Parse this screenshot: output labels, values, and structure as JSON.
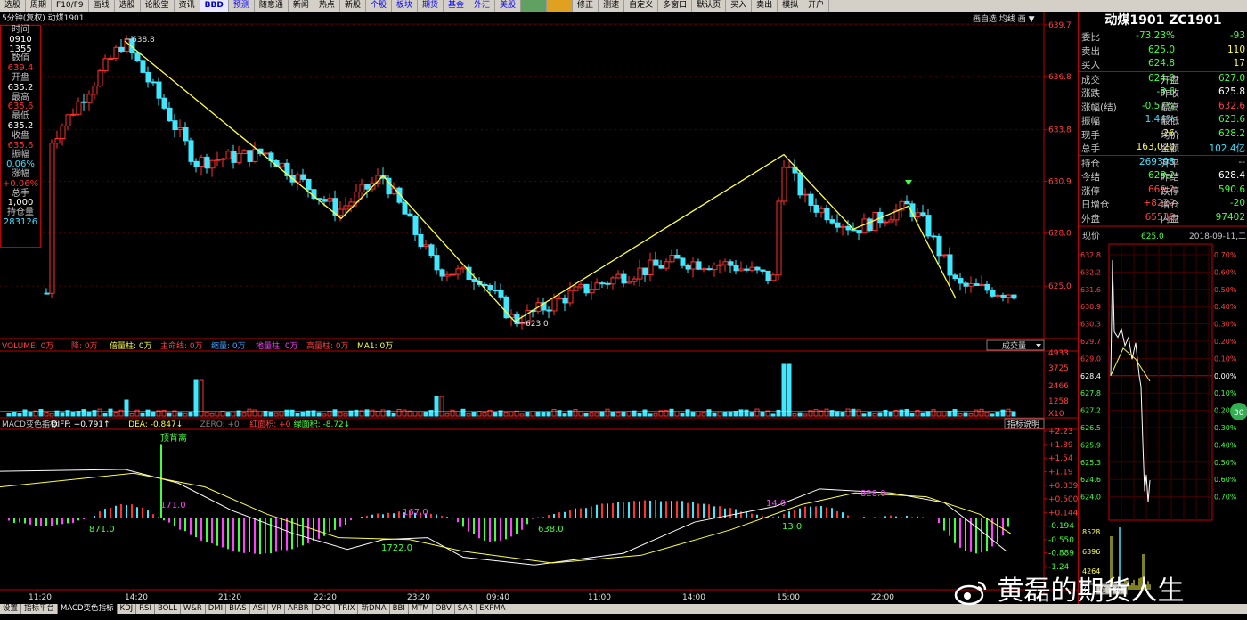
{
  "toolbar": {
    "items": [
      "选股",
      "周期",
      "F10/F9",
      "画线",
      "选股",
      "论股堂",
      "资讯",
      "BBD",
      "预测",
      "随意通",
      "新闻",
      "热点",
      "新股",
      "个股",
      "板块",
      "期货",
      "基金",
      "外汇",
      "美股",
      "",
      "",
      "修正",
      "测速",
      "自定义",
      "多窗口",
      "默认页",
      "买入",
      "卖出",
      "模拟",
      "开户"
    ]
  },
  "chart": {
    "header": "5分钟(复权) 动煤1901",
    "top_right_buttons": "画自选 均线 画 ▼",
    "price_axis": [
      "639.7",
      "636.8",
      "633.8",
      "630.9",
      "628.0",
      "625.0"
    ],
    "annotations": {
      "high": "638.8",
      "low": "623.0"
    },
    "time_axis": [
      "11:20",
      "14:20",
      "21:20",
      "22:20",
      "23:20",
      "09:40",
      "11:00",
      "14:00",
      "15:00",
      "22:00"
    ]
  },
  "info_panel": {
    "rows": [
      {
        "l": "时间",
        "v": "0910"
      },
      {
        "l": "",
        "v": "1355"
      },
      {
        "l": "数值",
        "v": "639.4",
        "c": "vred"
      },
      {
        "l": "开盘",
        "v": "635.2",
        "c": "vwhite"
      },
      {
        "l": "最高",
        "v": "635.6",
        "c": "vred"
      },
      {
        "l": "最低",
        "v": "635.2",
        "c": "vwhite"
      },
      {
        "l": "收盘",
        "v": "635.6",
        "c": "vred"
      },
      {
        "l": "振幅",
        "v": "0.06%",
        "c": "vcyan"
      },
      {
        "l": "涨幅",
        "v": "+0.06%",
        "c": "vred"
      },
      {
        "l": "总手",
        "v": "1,000",
        "c": "vwhite"
      },
      {
        "l": "持仓量",
        "v": "283126",
        "c": "vcyan"
      }
    ]
  },
  "volume": {
    "legend": [
      {
        "t": "VOLUME: 0万",
        "c": "#ff4040"
      },
      {
        "t": "降: 0万",
        "c": "#ff4040"
      },
      {
        "t": "倍量柱: 0万",
        "c": "#ffff40"
      },
      {
        "t": "主命线: 0万",
        "c": "#ff4040"
      },
      {
        "t": "缩量: 0万",
        "c": "#40a0ff"
      },
      {
        "t": "地量柱: 0万",
        "c": "#ff40ff"
      },
      {
        "t": "高量柱: 0万",
        "c": "#ff4040"
      },
      {
        "t": "MA1: 0万",
        "c": "#ffff40"
      }
    ],
    "selector": "成交量",
    "axis": [
      "4933",
      "3725",
      "2466",
      "1258",
      "X10"
    ]
  },
  "macd": {
    "legend": [
      {
        "t": "MACD变色指标",
        "c": "#c8c8c8"
      },
      {
        "t": "DIFF: +0.791↑",
        "c": "#ffffff"
      },
      {
        "t": "DEA: -0.847↓",
        "c": "#ffff40"
      },
      {
        "t": "ZERO: +0",
        "c": "#808080"
      },
      {
        "t": "红面积: +0",
        "c": "#ff4040"
      },
      {
        "t": "绿面积: -8.72↓",
        "c": "#40ff40"
      }
    ],
    "help": "指标说明",
    "axis": [
      "+2.23",
      "+1.89",
      "+1.54",
      "+1.19",
      "+0.839",
      "+0.500",
      "+0.144",
      "-0.194",
      "-0.550",
      "-0.889",
      "-1.24"
    ],
    "labels": [
      "顶背离",
      "171.0",
      "871.0",
      "167.0",
      "1722.0",
      "638.0",
      "14.0",
      "13.0",
      "828.0"
    ]
  },
  "quote": {
    "title": "动煤1901 ZC1901",
    "rows": [
      [
        {
          "t": "委比",
          "c": "#c8c8c8"
        },
        {
          "t": "-73.23%",
          "c": "#40ff40"
        },
        {
          "t": "",
          "c": ""
        },
        {
          "t": "-93",
          "c": "#40ff40"
        }
      ],
      [
        {
          "t": "卖出",
          "c": "#c8c8c8"
        },
        {
          "t": "625.0",
          "c": "#40ff40"
        },
        {
          "t": "",
          "c": ""
        },
        {
          "t": "110",
          "c": "#ffff40"
        }
      ],
      [
        {
          "t": "买入",
          "c": "#c8c8c8"
        },
        {
          "t": "624.8",
          "c": "#40ff40"
        },
        {
          "t": "",
          "c": ""
        },
        {
          "t": "17",
          "c": "#ffff40"
        }
      ],
      [
        {
          "t": "成交",
          "c": "#c8c8c8"
        },
        {
          "t": "624.0",
          "c": "#40ff40"
        },
        {
          "t": "开盘",
          "c": "#c8c8c8"
        },
        {
          "t": "627.0",
          "c": "#40ff40"
        }
      ],
      [
        {
          "t": "涨跌",
          "c": "#c8c8c8"
        },
        {
          "t": "-3.6",
          "c": "#40ff40"
        },
        {
          "t": "昨收",
          "c": "#c8c8c8"
        },
        {
          "t": "625.8",
          "c": "#ffffff"
        }
      ],
      [
        {
          "t": "涨幅(结)",
          "c": "#c8c8c8"
        },
        {
          "t": "-0.57%",
          "c": "#40ff40"
        },
        {
          "t": "最高",
          "c": "#c8c8c8"
        },
        {
          "t": "632.6",
          "c": "#ff4040"
        }
      ],
      [
        {
          "t": "振幅",
          "c": "#c8c8c8"
        },
        {
          "t": "1.44%",
          "c": "#40e0ff"
        },
        {
          "t": "最低",
          "c": "#c8c8c8"
        },
        {
          "t": "623.6",
          "c": "#40ff40"
        }
      ],
      [
        {
          "t": "现手",
          "c": "#c8c8c8"
        },
        {
          "t": "26",
          "c": "#ffff40"
        },
        {
          "t": "均价",
          "c": "#c8c8c8"
        },
        {
          "t": "628.2",
          "c": "#40ff40"
        }
      ],
      [
        {
          "t": "总手",
          "c": "#c8c8c8"
        },
        {
          "t": "163,020",
          "c": "#ffff40"
        },
        {
          "t": "金额",
          "c": "#c8c8c8"
        },
        {
          "t": "102.4亿",
          "c": "#40e0ff"
        }
      ],
      [
        {
          "t": "持仓",
          "c": "#c8c8c8"
        },
        {
          "t": "269398",
          "c": "#40e0ff"
        },
        {
          "t": "开平",
          "c": "#c8c8c8"
        },
        {
          "t": "--",
          "c": "#c8c8c8"
        }
      ],
      [
        {
          "t": "今结",
          "c": "#c8c8c8"
        },
        {
          "t": "628.2",
          "c": "#40ff40"
        },
        {
          "t": "昨结",
          "c": "#c8c8c8"
        },
        {
          "t": "628.4",
          "c": "#ffffff"
        }
      ],
      [
        {
          "t": "涨停",
          "c": "#c8c8c8"
        },
        {
          "t": "666.2",
          "c": "#ff4040"
        },
        {
          "t": "跌停",
          "c": "#c8c8c8"
        },
        {
          "t": "590.6",
          "c": "#40ff40"
        }
      ],
      [
        {
          "t": "日增仓",
          "c": "#c8c8c8"
        },
        {
          "t": "+8220",
          "c": "#ff4040"
        },
        {
          "t": "增仓",
          "c": "#c8c8c8"
        },
        {
          "t": "-20",
          "c": "#40ff40"
        }
      ],
      [
        {
          "t": "外盘",
          "c": "#c8c8c8"
        },
        {
          "t": "65530",
          "c": "#ff4040"
        },
        {
          "t": "内盘",
          "c": "#c8c8c8"
        },
        {
          "t": "97402",
          "c": "#40ff40"
        }
      ]
    ],
    "now_label": "现价",
    "now_value": "625.0",
    "date": "2018-09-11,二",
    "mini_axis_left": [
      "632.8",
      "632.2",
      "631.6",
      "630.9",
      "630.3",
      "629.7",
      "629.0",
      "628.4",
      "627.8",
      "627.2",
      "626.5",
      "625.9",
      "625.3",
      "624.6",
      "624.0"
    ],
    "mini_axis_right": [
      "0.70%",
      "0.60%",
      "0.50%",
      "0.40%",
      "0.30%",
      "0.20%",
      "0.10%",
      "0.00%",
      "0.10%",
      "0.20%",
      "0.30%",
      "0.40%",
      "0.50%",
      "0.60%",
      "0.70%"
    ],
    "mini_vol_axis": [
      "8528",
      "6396",
      "4264"
    ],
    "mini_badge": "30",
    "mini_tabs": [
      "分",
      "笔",
      "价"
    ]
  },
  "tabs": [
    "设置",
    "指标平台",
    "MACD变色指标",
    "KDJ",
    "RSI",
    "BOLL",
    "W&R",
    "DMI",
    "BIAS",
    "ASI",
    "VR",
    "ARBR",
    "DPO",
    "TRIX",
    "新DMA",
    "BBI",
    "MTM",
    "OBV",
    "SAR",
    "EXPMA"
  ],
  "watermark": "黄磊的期货人生"
}
